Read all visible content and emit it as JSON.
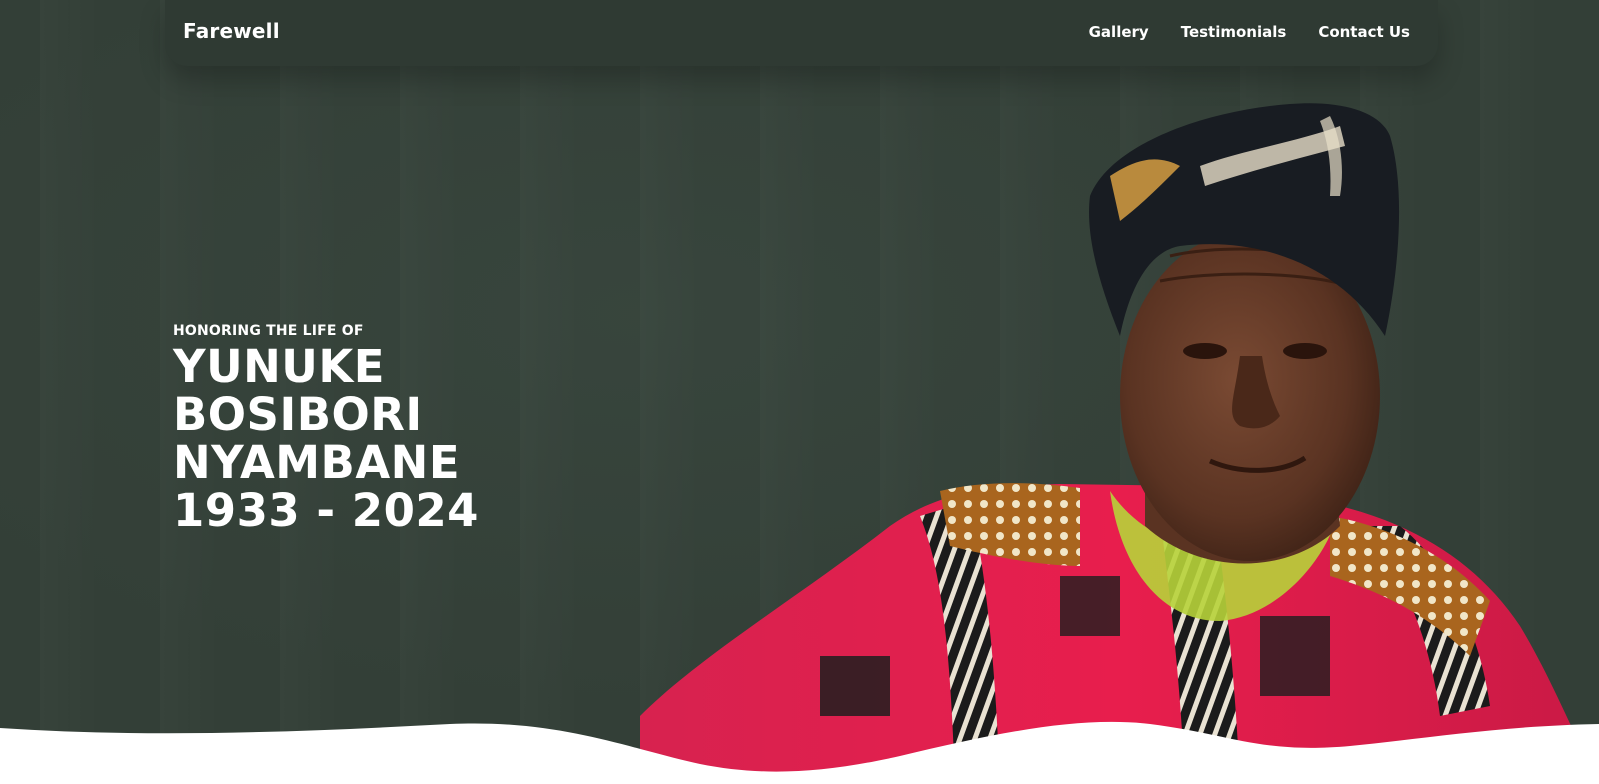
{
  "nav": {
    "brand": "Farewell",
    "links": [
      "Gallery",
      "Testimonials",
      "Contact Us"
    ]
  },
  "hero": {
    "eyebrow": "HONORING THE LIFE OF",
    "name_lines": [
      "YUNUKE",
      "BOSIBORI",
      "NYAMBANE"
    ],
    "years": "1933 - 2024",
    "portrait_icon": "portrait-photo"
  },
  "colors": {
    "hero_bg": "#333f37",
    "nav_bg": "#2f3a33",
    "text": "#ffffff",
    "wave": "#ffffff"
  }
}
